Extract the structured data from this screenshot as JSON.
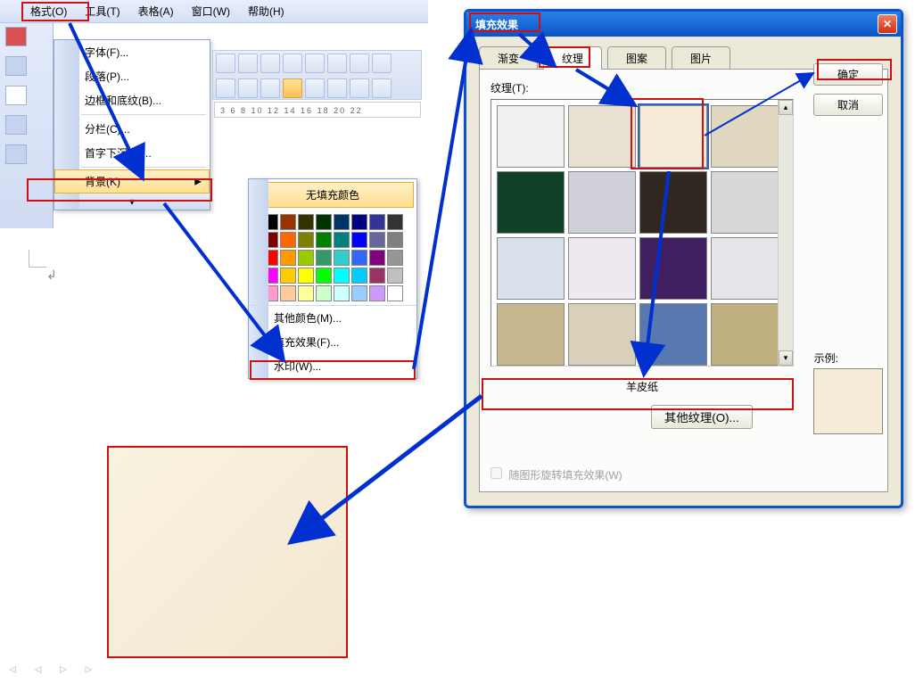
{
  "menubar": {
    "format": "格式(O)",
    "tools": "工具(T)",
    "table": "表格(A)",
    "window": "窗口(W)",
    "help": "帮助(H)"
  },
  "format_menu": {
    "font": "字体(F)...",
    "paragraph": "段落(P)...",
    "borders": "边框和底纹(B)...",
    "columns": "分栏(C)...",
    "dropcap": "首字下沉(D)...",
    "background": "背景(K)",
    "expand": "▾"
  },
  "ruler_text": "3   6   8   10  12  14  16  18  20  22",
  "color_popup": {
    "no_fill": "无填充颜色",
    "more_colors": "其他颜色(M)...",
    "fill_effects": "填充效果(F)...",
    "watermark": "水印(W)...",
    "colors_r1": [
      "#000000",
      "#993300",
      "#333300",
      "#003300",
      "#003366",
      "#000080",
      "#333399",
      "#333333"
    ],
    "colors_r2": [
      "#800000",
      "#ff6600",
      "#808000",
      "#008000",
      "#008080",
      "#0000ff",
      "#666699",
      "#808080"
    ],
    "colors_r3": [
      "#ff0000",
      "#ff9900",
      "#99cc00",
      "#339966",
      "#33cccc",
      "#3366ff",
      "#800080",
      "#969696"
    ],
    "colors_r4": [
      "#ff00ff",
      "#ffcc00",
      "#ffff00",
      "#00ff00",
      "#00ffff",
      "#00ccff",
      "#993366",
      "#c0c0c0"
    ],
    "colors_r5": [
      "#ff99cc",
      "#ffcc99",
      "#ffff99",
      "#ccffcc",
      "#ccffff",
      "#99ccff",
      "#cc99ff",
      "#ffffff"
    ]
  },
  "dialog": {
    "title": "填充效果",
    "close": "✕",
    "tabs": {
      "gradient": "渐变",
      "texture": "纹理",
      "pattern": "图案",
      "picture": "图片"
    },
    "texture_label": "纹理(T):",
    "selected_texture": "羊皮纸",
    "other_texture": "其他纹理(O)...",
    "rotate_label": "随图形旋转填充效果(W)",
    "ok": "确定",
    "cancel": "取消",
    "sample_label": "示例:",
    "textures": [
      "#f0f0f0",
      "#e8e0d0",
      "#f6ecd8",
      "#e0d8c0",
      "#104028",
      "#d0d0d8",
      "#302820",
      "#d8d8d8",
      "#d8e0ec",
      "#f0e8f0",
      "#402060",
      "#e8e4ec",
      "#c8b890",
      "#d8d0b8",
      "#5878b0",
      "#c0b080"
    ]
  },
  "nav": "◃ ◃ ▹ ▹"
}
